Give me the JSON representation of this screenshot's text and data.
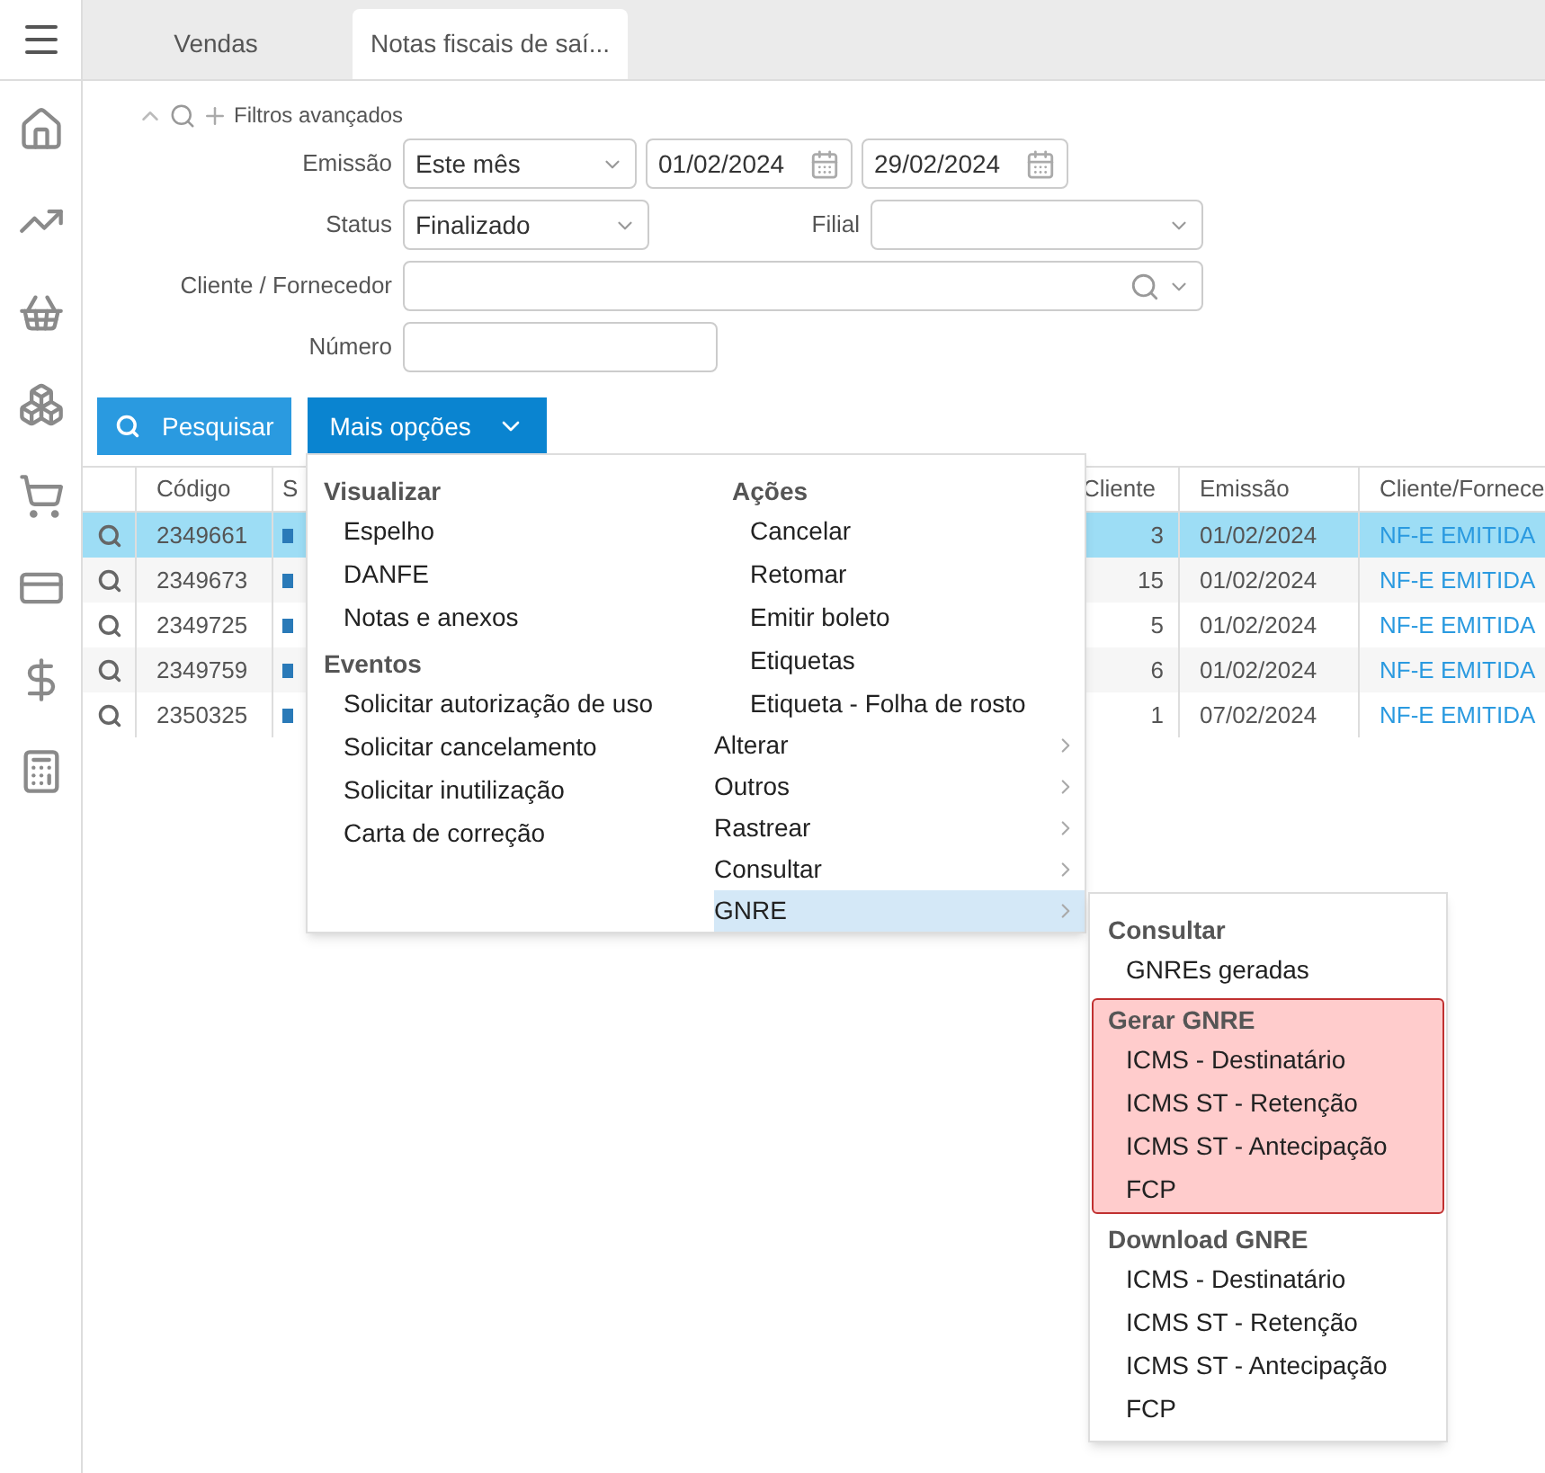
{
  "tabs": [
    {
      "label": "Vendas",
      "selected": false
    },
    {
      "label": "Notas fiscais de saí...",
      "selected": true
    }
  ],
  "filters": {
    "toggle_label": "Filtros avançados",
    "emissao": {
      "label": "Emissão",
      "value": "Este mês",
      "date_from": "01/02/2024",
      "date_to": "29/02/2024"
    },
    "status": {
      "label": "Status",
      "value": "Finalizado"
    },
    "filial": {
      "label": "Filial"
    },
    "cliente": {
      "label": "Cliente / Fornecedor"
    },
    "numero": {
      "label": "Número"
    }
  },
  "buttons": {
    "search": "Pesquisar",
    "more": "Mais opções"
  },
  "table": {
    "columns": [
      "Código",
      "S",
      "Cliente",
      "Emissão",
      "Cliente/Fornece"
    ],
    "rows": [
      {
        "codigo": "2349661",
        "cliente": "3",
        "emissao": "01/02/2024",
        "situacao": "NF-E EMITIDA",
        "selected": true
      },
      {
        "codigo": "2349673",
        "cliente": "15",
        "emissao": "01/02/2024",
        "situacao": "NF-E EMITIDA",
        "selected": false
      },
      {
        "codigo": "2349725",
        "cliente": "5",
        "emissao": "01/02/2024",
        "situacao": "NF-E EMITIDA",
        "selected": false
      },
      {
        "codigo": "2349759",
        "cliente": "6",
        "emissao": "01/02/2024",
        "situacao": "NF-E EMITIDA",
        "selected": false
      },
      {
        "codigo": "2350325",
        "cliente": "1",
        "emissao": "07/02/2024",
        "situacao": "NF-E EMITIDA",
        "selected": false
      }
    ]
  },
  "menu": {
    "left_sections": [
      {
        "heading": "Visualizar",
        "items": [
          "Espelho",
          "DANFE",
          "Notas e anexos"
        ]
      },
      {
        "heading": "Eventos",
        "items": [
          "Solicitar autorização de uso",
          "Solicitar cancelamento",
          "Solicitar inutilização",
          "Carta de correção"
        ]
      }
    ],
    "actions": {
      "heading": "Ações",
      "items": [
        "Cancelar",
        "Retomar",
        "Emitir boleto",
        "Etiquetas",
        "Etiqueta - Folha de rosto"
      ]
    },
    "submenus": [
      {
        "label": "Alterar",
        "selected": false
      },
      {
        "label": "Outros",
        "selected": false
      },
      {
        "label": "Rastrear",
        "selected": false
      },
      {
        "label": "Consultar",
        "selected": false
      },
      {
        "label": "GNRE",
        "selected": true
      }
    ]
  },
  "gnre_menu": {
    "groups": [
      {
        "heading": "Consultar",
        "highlighted": false,
        "items": [
          "GNREs geradas"
        ]
      },
      {
        "heading": "Gerar GNRE",
        "highlighted": true,
        "items": [
          "ICMS - Destinatário",
          "ICMS ST - Retenção",
          "ICMS ST - Antecipação",
          "FCP"
        ]
      },
      {
        "heading": "Download GNRE",
        "highlighted": false,
        "items": [
          "ICMS - Destinatário",
          "ICMS ST - Retenção",
          "ICMS ST - Antecipação",
          "FCP"
        ]
      }
    ]
  }
}
